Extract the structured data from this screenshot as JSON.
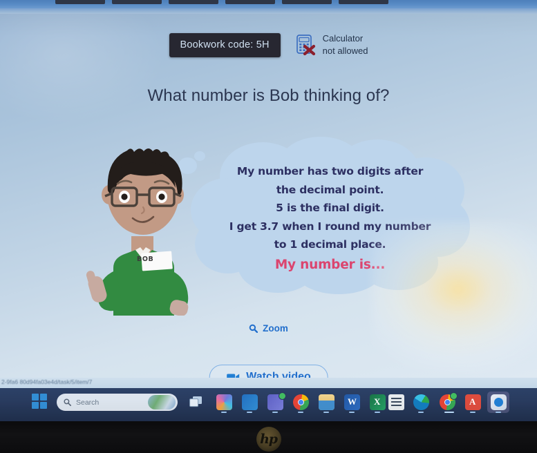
{
  "browser": {
    "tabs": [
      "",
      "",
      "",
      "",
      "",
      ""
    ],
    "status_url": "2-9fa6  80d94fa03e4d/task/5/item/7"
  },
  "header": {
    "bookwork_code": "Bookwork code: 5H",
    "calculator_line1": "Calculator",
    "calculator_line2": "not allowed",
    "calculator_icon": "calculator-not-allowed-icon"
  },
  "question": {
    "title": "What number is Bob thinking of?"
  },
  "character": {
    "name": "BOB",
    "shirt_color": "#2f8c3f",
    "hair_color": "#221c19",
    "skin_color": "#c49a84"
  },
  "bubble": {
    "fill_color": "#bdd6ee",
    "text_color": "#2c2f63",
    "answer_color": "#e0436f",
    "lines": [
      "My number has two digits after",
      "the decimal point.",
      "5 is the final digit.",
      "I get 3.7 when I round my number",
      "to 1 decimal place."
    ],
    "answer_line": "My number is..."
  },
  "actions": {
    "zoom_label": "Zoom",
    "zoom_icon": "magnifier-icon",
    "watch_video_label": "Watch video",
    "watch_video_icon": "video-camera-icon",
    "link_color": "#1f6fd0"
  },
  "taskbar": {
    "start_icon": "windows-start-icon",
    "search_placeholder": "Search",
    "search_icon": "search-icon",
    "taskview_icon": "task-view-icon",
    "apps": [
      {
        "name": "copilot",
        "label": "Copilot"
      },
      {
        "name": "outlook",
        "label": "Outlook"
      },
      {
        "name": "teams",
        "label": "Teams"
      },
      {
        "name": "chrome",
        "label": "Google Chrome"
      },
      {
        "name": "file-explorer",
        "label": "File Explorer"
      },
      {
        "name": "word",
        "label": "Word"
      },
      {
        "name": "excel",
        "label": "Excel"
      },
      {
        "name": "sticky-notes",
        "label": "Sticky Notes"
      },
      {
        "name": "edge",
        "label": "Microsoft Edge"
      },
      {
        "name": "chrome-2",
        "label": "Google Chrome"
      },
      {
        "name": "acrobat",
        "label": "Adobe Acrobat"
      },
      {
        "name": "outlook-new",
        "label": "Outlook (New)"
      }
    ]
  },
  "monitor": {
    "brand": "hp"
  }
}
